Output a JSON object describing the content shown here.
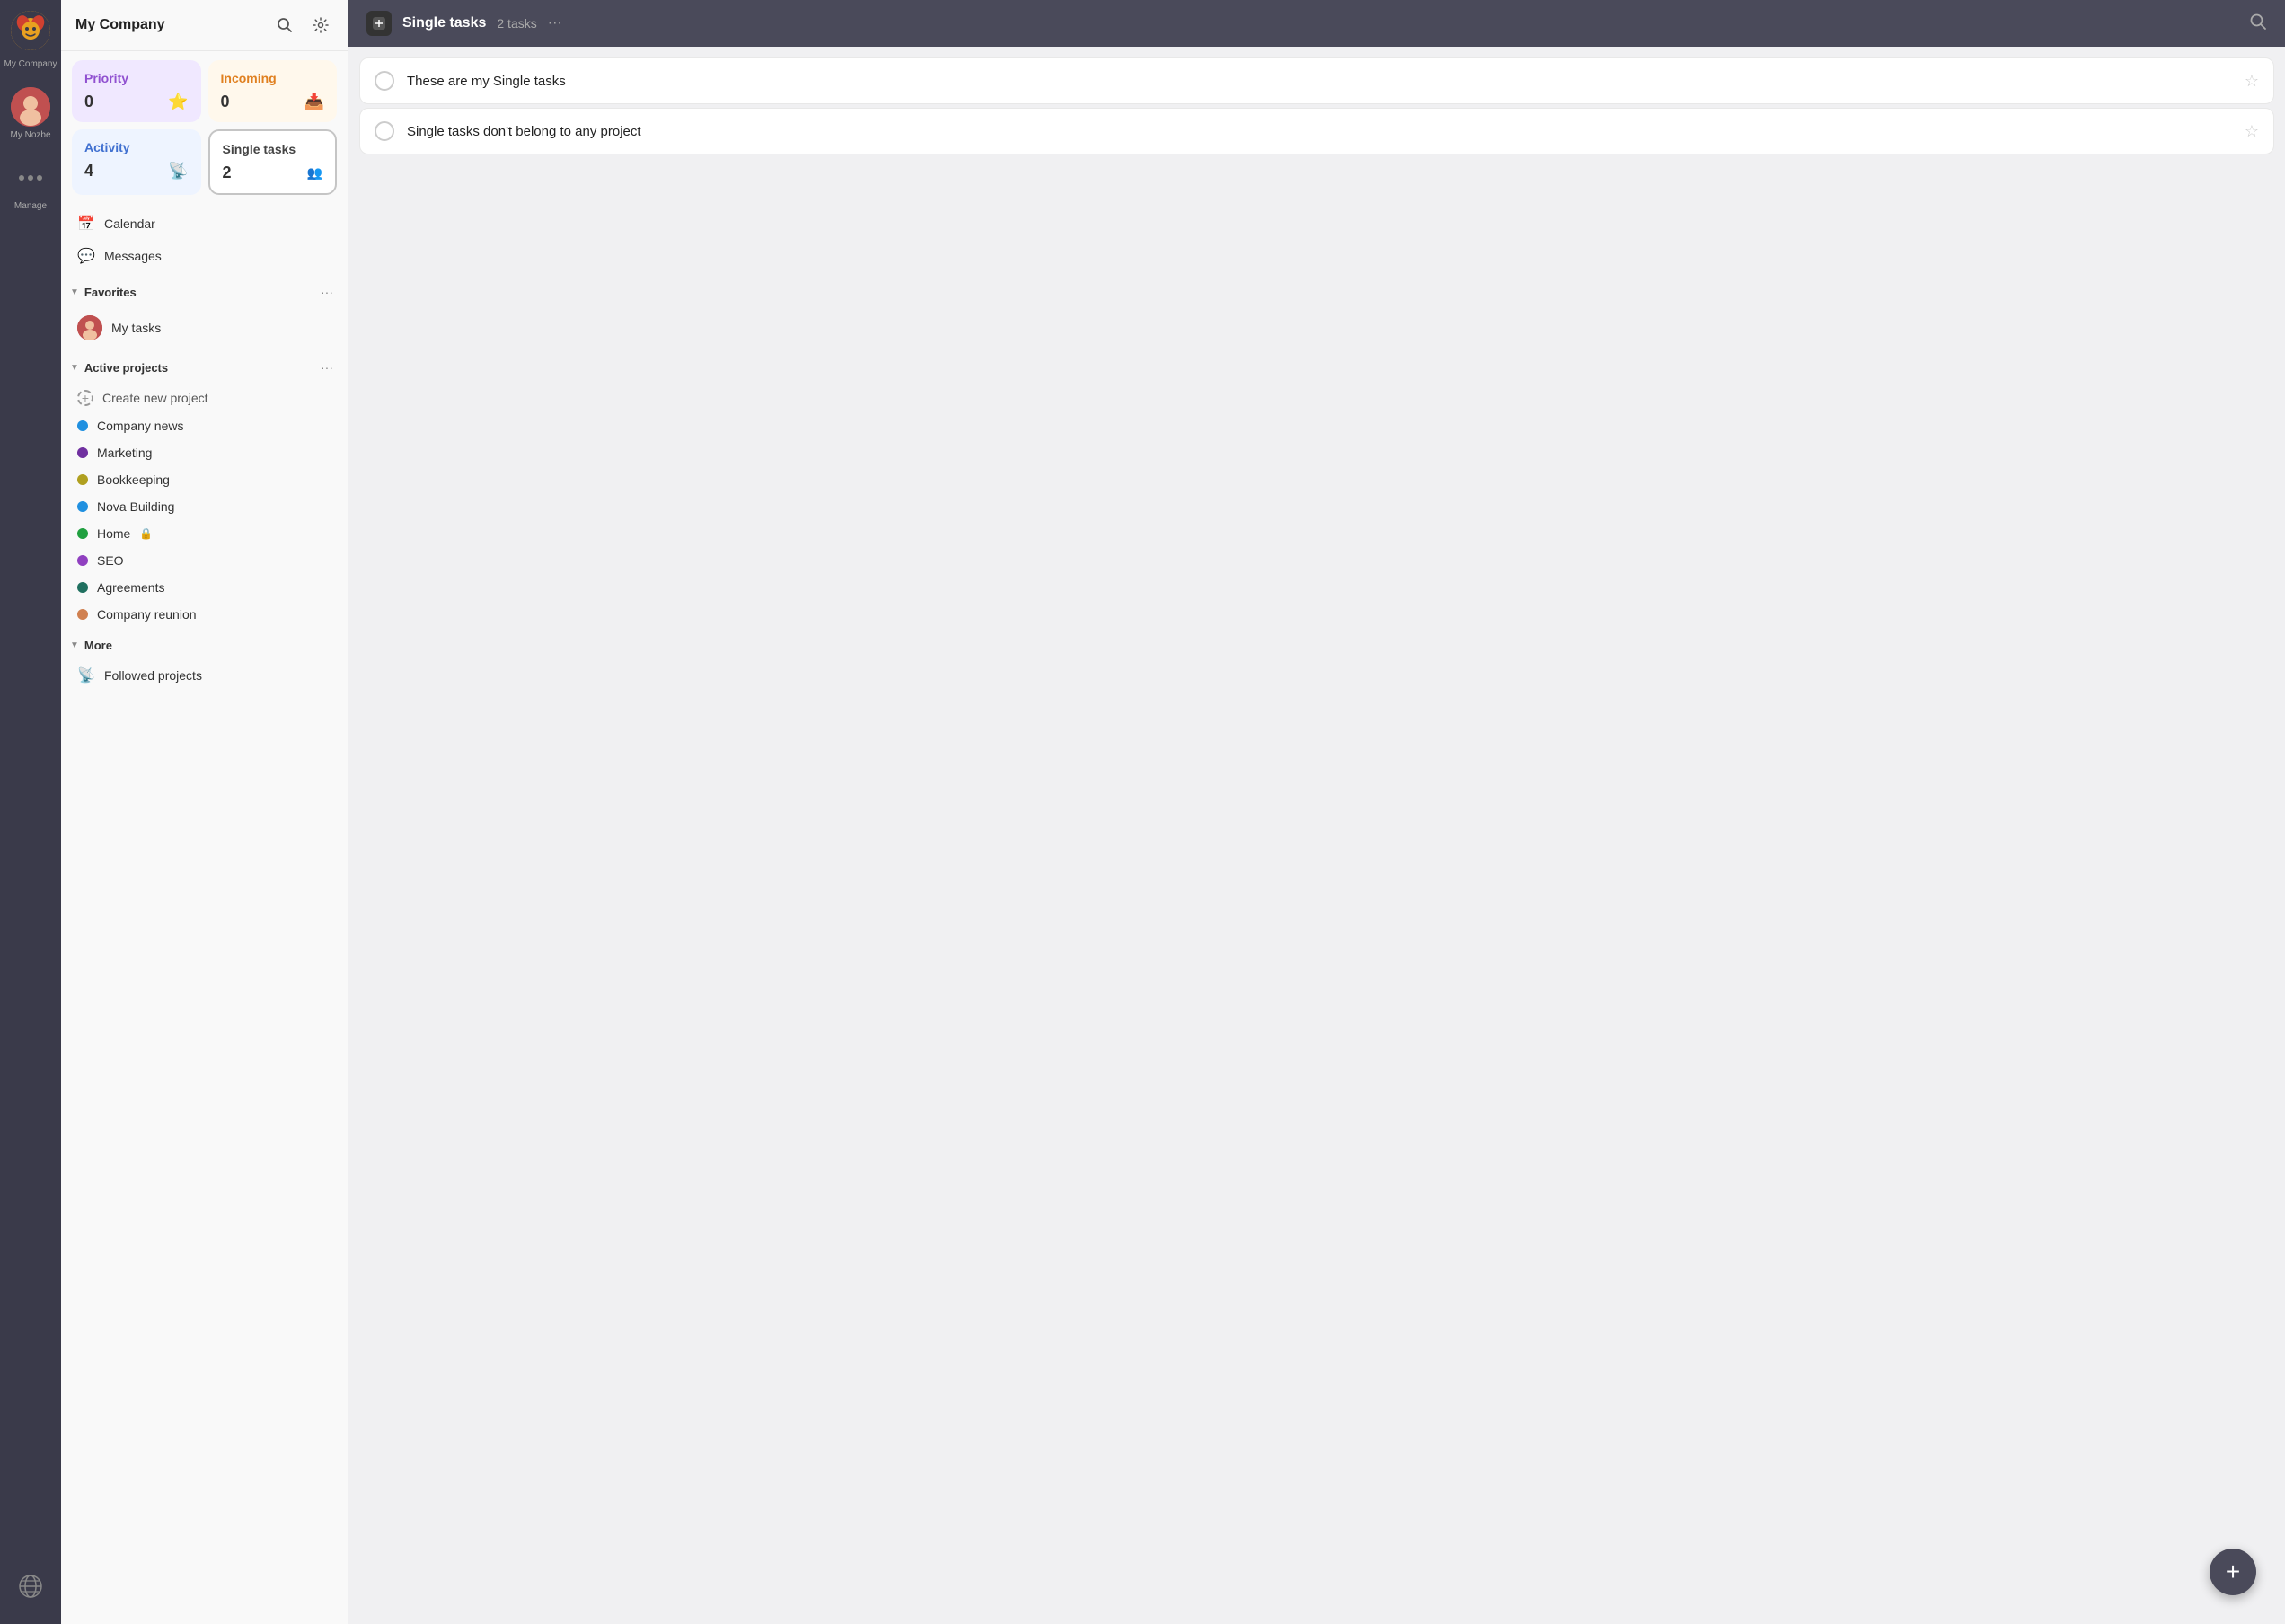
{
  "rail": {
    "company_label": "My Company",
    "user_label": "My Nozbe",
    "manage_label": "Manage",
    "globe_label": "World"
  },
  "sidebar": {
    "title": "My Company",
    "cards": {
      "priority": {
        "label": "Priority",
        "count": "0"
      },
      "incoming": {
        "label": "Incoming",
        "count": "0"
      },
      "activity": {
        "label": "Activity",
        "count": "4"
      },
      "single": {
        "label": "Single tasks",
        "count": "2"
      }
    },
    "nav": [
      {
        "icon": "📅",
        "label": "Calendar"
      },
      {
        "icon": "💬",
        "label": "Messages"
      }
    ],
    "favorites": {
      "title": "Favorites",
      "items": [
        {
          "label": "My tasks"
        }
      ]
    },
    "active_projects": {
      "title": "Active projects",
      "create_label": "Create new project",
      "items": [
        {
          "label": "Company news",
          "color": "#2090e0"
        },
        {
          "label": "Marketing",
          "color": "#7030a0"
        },
        {
          "label": "Bookkeeping",
          "color": "#b0a020"
        },
        {
          "label": "Nova Building",
          "color": "#2090e0"
        },
        {
          "label": "Home",
          "color": "#20a040",
          "locked": true
        },
        {
          "label": "SEO",
          "color": "#9040c0"
        },
        {
          "label": "Agreements",
          "color": "#207060"
        },
        {
          "label": "Company reunion",
          "color": "#d08050"
        }
      ]
    },
    "more": {
      "title": "More",
      "items": [
        {
          "icon": "📡",
          "label": "Followed projects"
        }
      ]
    }
  },
  "main": {
    "header": {
      "title": "Single tasks",
      "count": "2 tasks",
      "more": "···"
    },
    "tasks": [
      {
        "text": "These are my Single tasks"
      },
      {
        "text": "Single tasks don't belong to any project"
      }
    ],
    "fab_label": "+"
  },
  "colors": {
    "priority_bg": "#f0e8ff",
    "priority_text": "#9050d0",
    "incoming_bg": "#fff8ec",
    "incoming_text": "#e08020",
    "activity_bg": "#eef4ff",
    "activity_text": "#4070d0",
    "accent": "#4a4a5a"
  }
}
